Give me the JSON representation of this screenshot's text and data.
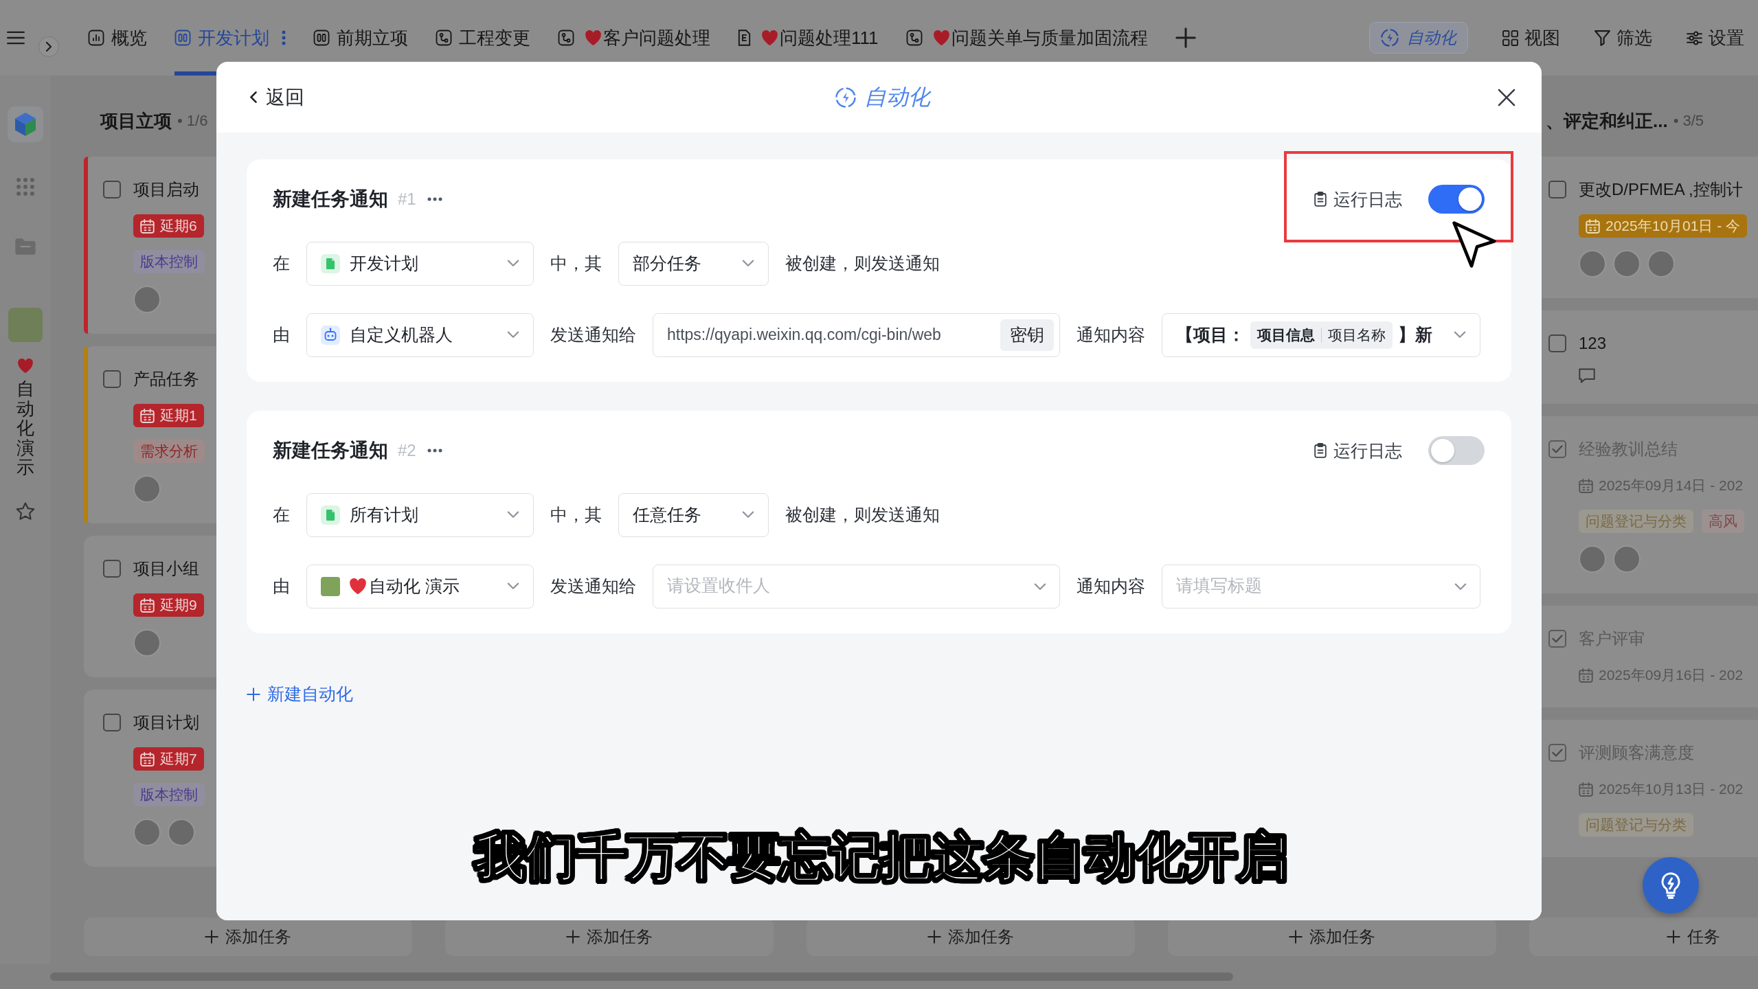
{
  "top_bar": {
    "tabs": [
      {
        "label": "概览",
        "kind": "chart",
        "heart": false,
        "selected": false
      },
      {
        "label": "开发计划",
        "kind": "board",
        "heart": false,
        "selected": true
      },
      {
        "label": "前期立项",
        "kind": "board",
        "heart": false,
        "selected": false
      },
      {
        "label": "工程变更",
        "kind": "flow",
        "heart": false,
        "selected": false
      },
      {
        "label": "客户问题处理",
        "kind": "flow",
        "heart": true,
        "selected": false
      },
      {
        "label": "问题处理111",
        "kind": "doc",
        "heart": true,
        "selected": false
      },
      {
        "label": "问题关单与质量加固流程",
        "kind": "flow",
        "heart": true,
        "selected": false
      }
    ],
    "actions": [
      {
        "label": "自动化",
        "kind": "automation",
        "selected": true
      },
      {
        "label": "视图",
        "kind": "view",
        "selected": false
      },
      {
        "label": "筛选",
        "kind": "filter",
        "selected": false
      },
      {
        "label": "设置",
        "kind": "settings",
        "selected": false
      }
    ]
  },
  "sidebar": {
    "project_name": "自动化演示",
    "heart": true
  },
  "board": {
    "columns": [
      {
        "title": "项目立项",
        "count": "• 1/6",
        "add_label": "添加任务",
        "cards": [
          {
            "title": "项目启动",
            "checked": false,
            "color": "#c0232b",
            "date": {
              "text": "延期6",
              "kind": "overdue"
            },
            "tags": [
              {
                "text": "版本控制",
                "color": "#4a3a8e"
              }
            ],
            "avatars": [
              {
                "kind": "photo"
              }
            ],
            "comment": false
          },
          {
            "title": "产品任务",
            "checked": false,
            "color": "#b3800e",
            "date": {
              "text": "延期1",
              "kind": "overdue"
            },
            "tags": [
              {
                "text": "需求分析",
                "color": "#8f2626"
              }
            ],
            "avatars": [
              {
                "kind": "photo"
              }
            ],
            "comment": false
          },
          {
            "title": "项目小组",
            "checked": false,
            "date": {
              "text": "延期9",
              "kind": "overdue"
            },
            "avatars": [
              {
                "kind": "photo"
              }
            ],
            "comment": false
          },
          {
            "title": "项目计划",
            "checked": false,
            "date": {
              "text": "延期7",
              "kind": "overdue"
            },
            "tags": [
              {
                "text": "版本控制",
                "color": "#4a3a8e"
              }
            ],
            "avatars": [
              {
                "kind": "photo"
              },
              {
                "kind": "photo"
              }
            ],
            "comment": false
          }
        ]
      },
      {
        "add_label": "添加任务"
      },
      {
        "add_label": "添加任务"
      },
      {
        "add_label": "添加任务"
      },
      {
        "title": "、评定和纠正...",
        "count": "• 3/5",
        "add_label": "任务",
        "cards": [
          {
            "title": "更改D/PFMEA ,控制计",
            "checked": false,
            "date": {
              "text": "2025年10月01日 - 今",
              "kind": "today"
            },
            "avatars": [
              {
                "kind": "photo"
              },
              {
                "kind": "photo"
              },
              {
                "kind": "photo"
              }
            ],
            "comment": false
          },
          {
            "title": "123",
            "checked": false,
            "comment": true
          },
          {
            "title": "经验教训总结",
            "checked": true,
            "date": {
              "text": "2025年09月14日 - 202",
              "kind": "plain"
            },
            "tags": [
              {
                "text": "问题登记与分类",
                "color": "#7a6a44"
              },
              {
                "text": "高风",
                "color": "#7e4a4a"
              }
            ],
            "avatars": [
              {
                "kind": "photo"
              },
              {
                "kind": "photo"
              }
            ],
            "comment": false
          },
          {
            "title": "客户评审",
            "checked": true,
            "date": {
              "text": "2025年09月16日 - 202",
              "kind": "plain"
            },
            "comment": false
          },
          {
            "title": "评测顾客满意度",
            "checked": true,
            "date": {
              "text": "2025年10月13日 - 202",
              "kind": "plain"
            },
            "tags": [
              {
                "text": "问题登记与分类",
                "color": "#7a6a44"
              }
            ],
            "comment": false
          }
        ]
      }
    ]
  },
  "modal": {
    "back_label": "返回",
    "title": "自动化",
    "automations": [
      {
        "title": "新建任务通知",
        "number": "#1",
        "log_label": "运行日志",
        "on": true,
        "trigger": {
          "in_label": "在",
          "plan": {
            "value": "开发计划"
          },
          "of_label": "中，其",
          "scope": {
            "value": "部分任务"
          },
          "suffix": "被创建，则发送通知"
        },
        "action": {
          "by_label": "由",
          "sender": {
            "value": "自定义机器人",
            "kind": "robot",
            "heart": false
          },
          "to_label": "发送通知给",
          "recipient": {
            "kind": "url",
            "value": "https://qyapi.weixin.qq.com/cgi-bin/web",
            "button": "密钥"
          },
          "content_label": "通知内容",
          "content": {
            "kind": "template",
            "parts": [
              {
                "kind": "text",
                "text": "【项目："
              },
              {
                "kind": "field",
                "group": "项目信息",
                "name": "项目名称"
              },
              {
                "kind": "text",
                "text": "】新"
              }
            ]
          }
        }
      },
      {
        "title": "新建任务通知",
        "number": "#2",
        "log_label": "运行日志",
        "on": false,
        "trigger": {
          "in_label": "在",
          "plan": {
            "value": "所有计划"
          },
          "of_label": "中，其",
          "scope": {
            "value": "任意任务"
          },
          "suffix": "被创建，则发送通知"
        },
        "action": {
          "by_label": "由",
          "sender": {
            "value": "自动化 演示",
            "kind": "project",
            "heart": true
          },
          "to_label": "发送通知给",
          "recipient": {
            "kind": "select",
            "placeholder": "请设置收件人"
          },
          "content_label": "通知内容",
          "content": {
            "kind": "select",
            "placeholder": "请填写标题"
          }
        }
      }
    ],
    "add_label": "新建自动化"
  },
  "subtitle": "我们千万不要忘记把这条自动化开启"
}
